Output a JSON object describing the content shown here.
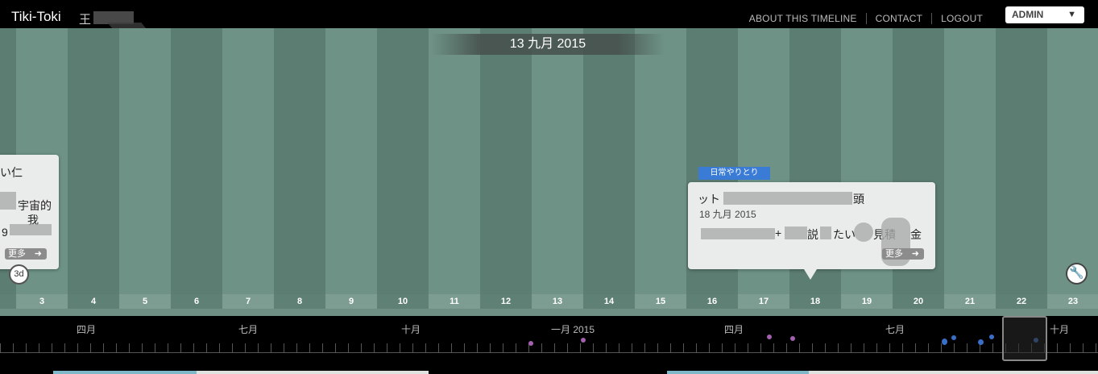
{
  "header": {
    "app_name": "Tiki-Toki",
    "user_label": "王",
    "nav": [
      "ABOUT THIS TIMELINE",
      "CONTACT",
      "LOGOUT"
    ],
    "admin_label": "ADMIN",
    "admin_arrow": "▼"
  },
  "timeline": {
    "current_date": "13 九月 2015",
    "days": [
      "3",
      "4",
      "5",
      "6",
      "7",
      "8",
      "9",
      "10",
      "11",
      "12",
      "13",
      "14",
      "15",
      "16",
      "17",
      "18",
      "19",
      "20",
      "21",
      "22",
      "23"
    ],
    "zoom_label": "3d",
    "tool_icon": "wrench-icon"
  },
  "cards": [
    {
      "lines": [
        "い仁",
        "宇宙的",
        "我",
        "9"
      ],
      "more": "更多"
    },
    {
      "tag": "日常やりとり",
      "title_start": "ット",
      "title_end": "頭",
      "date": "18 九月 2015",
      "body": [
        "+",
        "説",
        "たい",
        "見積",
        "金"
      ],
      "more": "更多"
    }
  ],
  "mini": {
    "months": [
      "四月",
      "七月",
      "十月",
      "一月 2015",
      "四月",
      "七月",
      "十月"
    ]
  },
  "colors": {
    "accent_tag": "#3a7bd5",
    "stripe_dark": "#5c7d72",
    "stripe_light": "#6e9386"
  }
}
